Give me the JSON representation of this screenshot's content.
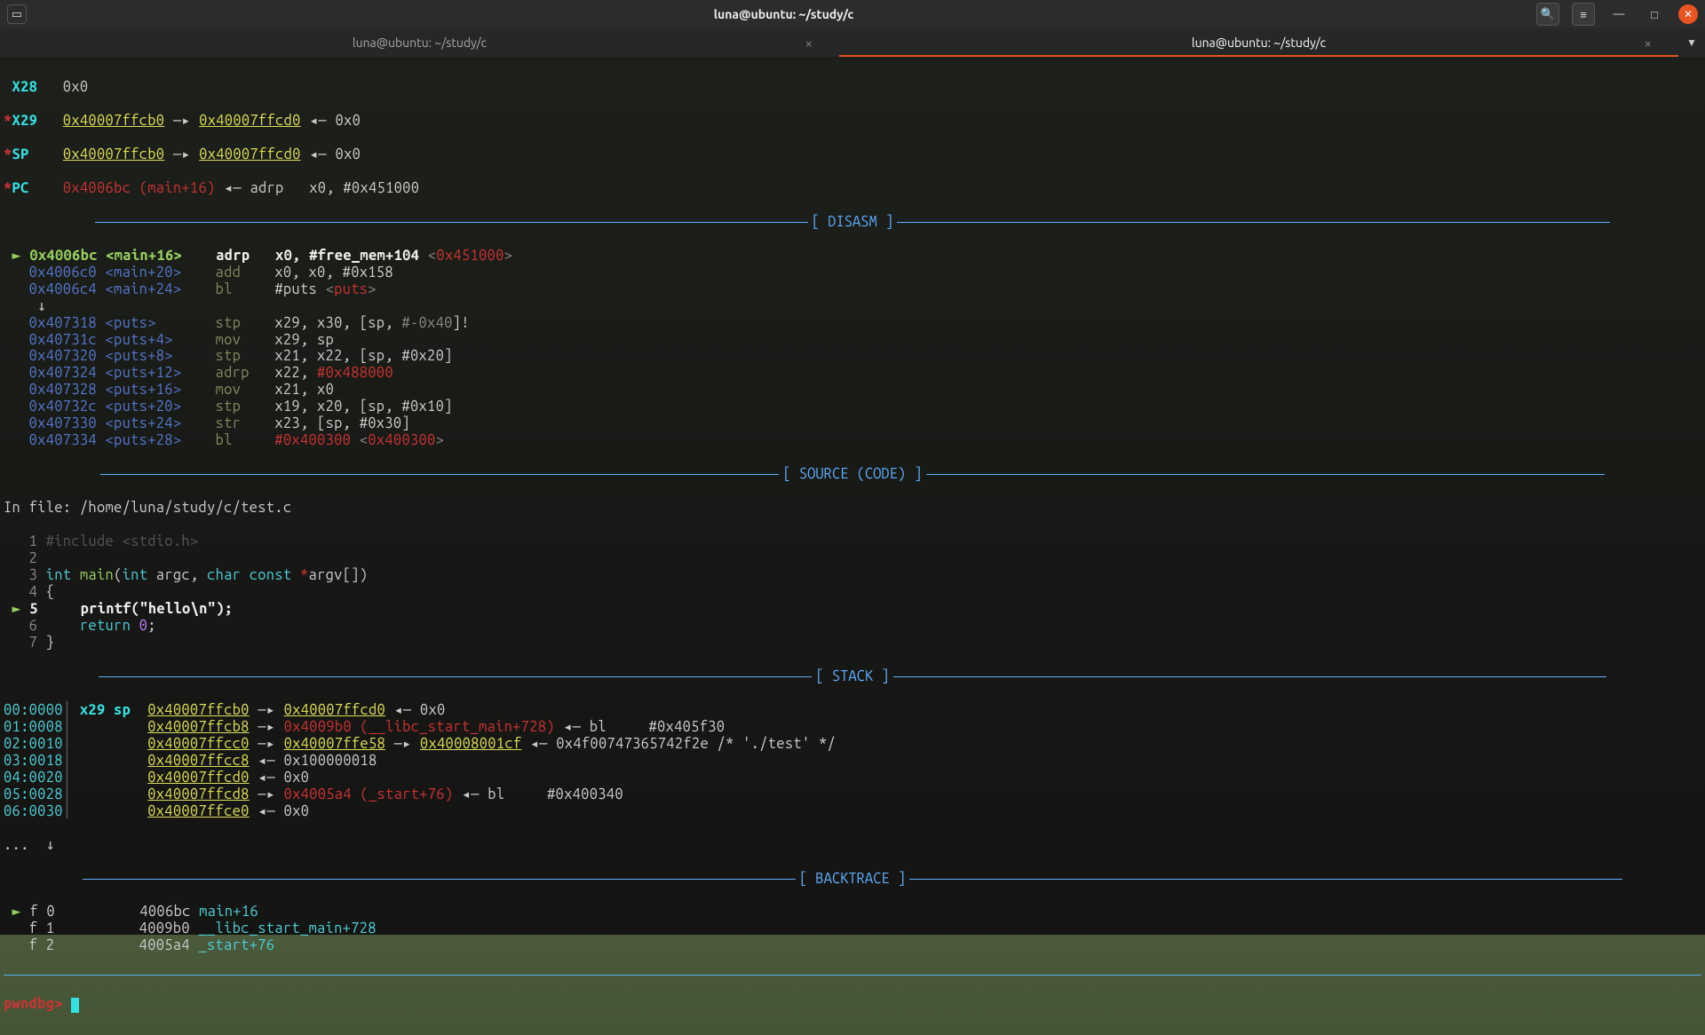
{
  "titlebar": {
    "title": "luna@ubuntu: ~/study/c"
  },
  "tabs": [
    {
      "label": "luna@ubuntu: ~/study/c",
      "active": false
    },
    {
      "label": "luna@ubuntu: ~/study/c",
      "active": true
    }
  ],
  "registers": {
    "x28": {
      "name": " X28",
      "val": "0x0"
    },
    "x29": {
      "name": "*X29",
      "addr1": "0x40007ffcb0",
      "arrow1": "—▸",
      "addr2": "0x40007ffcd0",
      "arrow2": "◂—",
      "val": "0x0"
    },
    "sp": {
      "name": "*SP",
      "addr1": "0x40007ffcb0",
      "arrow1": "—▸",
      "addr2": "0x40007ffcd0",
      "arrow2": "◂—",
      "val": "0x0"
    },
    "pc": {
      "name": "*PC",
      "addr": "0x4006bc",
      "sym": "(main+16)",
      "arrow": "◂—",
      "instr": "adrp   x0, #0x451000"
    }
  },
  "sections": {
    "disasm": "DISASM",
    "source": "SOURCE (CODE)",
    "stack": "STACK",
    "backtrace": "BACKTRACE"
  },
  "disasm": [
    {
      "marker": " ►",
      "addr": "0x4006bc",
      "sym": "<main+16>",
      "op": "adrp",
      "args": "x0, #free_mem+104",
      "tail": "<0x451000>",
      "bold": true
    },
    {
      "marker": "  ",
      "addr": "0x4006c0",
      "sym": "<main+20>",
      "op": "add",
      "args": "x0, x0, #0x158"
    },
    {
      "marker": "  ",
      "addr": "0x4006c4",
      "sym": "<main+24>",
      "op": "bl",
      "args": "#puts ",
      "tail": "<puts>"
    },
    {
      "marker": "  ",
      "addr": "   ↓",
      "sym": "",
      "op": "",
      "args": ""
    },
    {
      "marker": "  ",
      "addr": "0x407318",
      "sym": "<puts>",
      "op": "stp",
      "args": "x29, x30, [sp, ",
      "tail": "#-0x40]!"
    },
    {
      "marker": "  ",
      "addr": "0x40731c",
      "sym": "<puts+4>",
      "op": "mov",
      "args": "x29, sp"
    },
    {
      "marker": "  ",
      "addr": "0x407320",
      "sym": "<puts+8>",
      "op": "stp",
      "args": "x21, x22, [sp, #0x20]"
    },
    {
      "marker": "  ",
      "addr": "0x407324",
      "sym": "<puts+12>",
      "op": "adrp",
      "args": "x22, ",
      "tail2": "#0x488000"
    },
    {
      "marker": "  ",
      "addr": "0x407328",
      "sym": "<puts+16>",
      "op": "mov",
      "args": "x21, x0"
    },
    {
      "marker": "  ",
      "addr": "0x40732c",
      "sym": "<puts+20>",
      "op": "stp",
      "args": "x19, x20, [sp, #0x10]"
    },
    {
      "marker": "  ",
      "addr": "0x407330",
      "sym": "<puts+24>",
      "op": "str",
      "args": "x23, [sp, #0x30]"
    },
    {
      "marker": "  ",
      "addr": "0x407334",
      "sym": "<puts+28>",
      "op": "bl",
      "args": "",
      "tail2a": "#0x400300 ",
      "tail3": "<0x400300>"
    }
  ],
  "source": {
    "file_label": "In file: ",
    "file_path": "/home/luna/study/c/test.c",
    "lines": [
      {
        "num": "1",
        "text_include": "#include ",
        "text_hdr": "<stdio.h>"
      },
      {
        "num": "2",
        "text": ""
      },
      {
        "num": "3",
        "kw": "int ",
        "fn": "main",
        "paren": "(",
        "kw2": "int ",
        "arg1": "argc, ",
        "kw3": "char const ",
        "star": "*",
        "arg2": "argv[])"
      },
      {
        "num": "4",
        "text": "{"
      },
      {
        "num": "5",
        "marker": " ►",
        "indent": "    ",
        "fn": "printf",
        "paren": "(",
        "str": "\"hello\\n\"",
        "rest": ");"
      },
      {
        "num": "6",
        "indent": "    ",
        "kw": "return ",
        "val": "0",
        ";": ";"
      },
      {
        "num": "7",
        "text": "}"
      }
    ]
  },
  "stack": [
    {
      "off": "00:0000",
      "reg": "x29 sp",
      "addr": "0x40007ffcb0",
      "a1": "—▸",
      "addr2": "0x40007ffcd0",
      "a2": "◂—",
      "val": "0x0"
    },
    {
      "off": "01:0008",
      "addr": "0x40007ffcb8",
      "a1": "—▸",
      "red": "0x4009b0 (__libc_start_main+728)",
      "a2": "◂—",
      "instr": "bl     #0x405f30"
    },
    {
      "off": "02:0010",
      "addr": "0x40007ffcc0",
      "a1": "—▸",
      "addr2": "0x40007ffe58",
      "a1b": "—▸",
      "addr3": "0x40008001cf",
      "a2": "◂—",
      "val": "0x4f00747365742f2e /* './test' */"
    },
    {
      "off": "03:0018",
      "addr": "0x40007ffcc8",
      "a1": "◂—",
      "val": "0x100000018"
    },
    {
      "off": "04:0020",
      "addr": "0x40007ffcd0",
      "a1": "◂—",
      "val": "0x0"
    },
    {
      "off": "05:0028",
      "addr": "0x40007ffcd8",
      "a1": "—▸",
      "red": "0x4005a4 (_start+76)",
      "a2": "◂—",
      "instr": "bl     #0x400340"
    },
    {
      "off": "06:0030",
      "addr": "0x40007ffce0",
      "a1": "◂—",
      "val": "0x0"
    }
  ],
  "stack_more": "...  ↓",
  "backtrace": [
    {
      "marker": " ►",
      "frame": "f 0",
      "addr": "          4006bc",
      "sym": "main+16"
    },
    {
      "marker": "  ",
      "frame": "f 1",
      "addr": "          4009b0",
      "sym": "__libc_start_main+728"
    },
    {
      "marker": "  ",
      "frame": "f 2",
      "addr": "          4005a4",
      "sym": "_start+76"
    }
  ],
  "prompt": "pwndbg> "
}
